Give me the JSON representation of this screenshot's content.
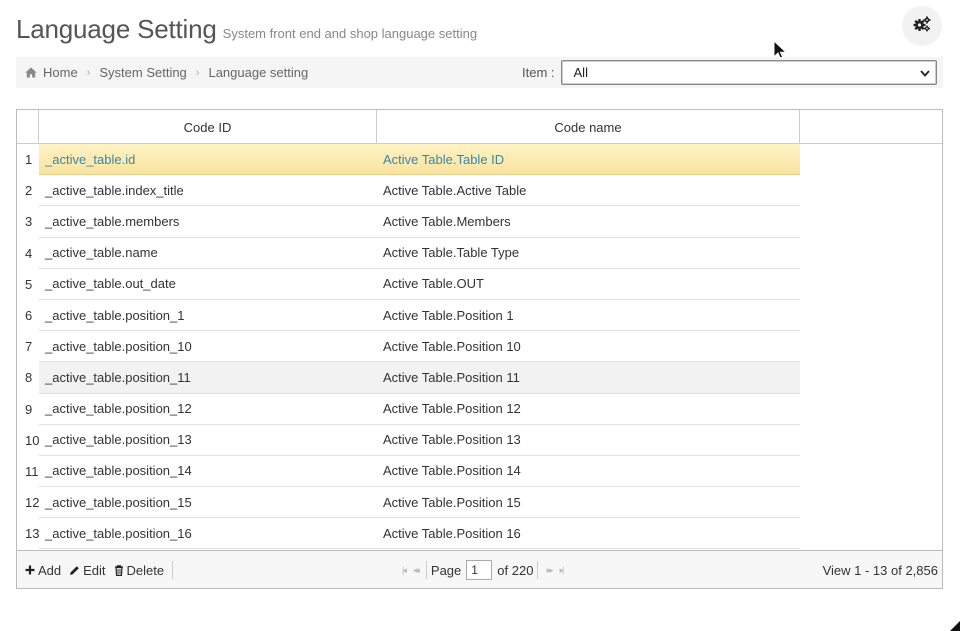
{
  "header": {
    "title": "Language Setting",
    "subtitle": "System front end and shop language setting"
  },
  "breadcrumb": {
    "items": [
      "Home",
      "System Setting",
      "Language setting"
    ],
    "separator": "›"
  },
  "filter": {
    "label": "Item :",
    "selected": "All"
  },
  "grid": {
    "columns": [
      "Code ID",
      "Code name"
    ],
    "rows": [
      {
        "n": "1",
        "id": "_active_table.id",
        "name": "Active Table.Table ID"
      },
      {
        "n": "2",
        "id": "_active_table.index_title",
        "name": "Active Table.Active Table"
      },
      {
        "n": "3",
        "id": "_active_table.members",
        "name": "Active Table.Members"
      },
      {
        "n": "4",
        "id": "_active_table.name",
        "name": "Active Table.Table Type"
      },
      {
        "n": "5",
        "id": "_active_table.out_date",
        "name": "Active Table.OUT"
      },
      {
        "n": "6",
        "id": "_active_table.position_1",
        "name": "Active Table.Position 1"
      },
      {
        "n": "7",
        "id": "_active_table.position_10",
        "name": "Active Table.Position 10"
      },
      {
        "n": "8",
        "id": "_active_table.position_11",
        "name": "Active Table.Position 11"
      },
      {
        "n": "9",
        "id": "_active_table.position_12",
        "name": "Active Table.Position 12"
      },
      {
        "n": "10",
        "id": "_active_table.position_13",
        "name": "Active Table.Position 13"
      },
      {
        "n": "11",
        "id": "_active_table.position_14",
        "name": "Active Table.Position 14"
      },
      {
        "n": "12",
        "id": "_active_table.position_15",
        "name": "Active Table.Position 15"
      },
      {
        "n": "13",
        "id": "_active_table.position_16",
        "name": "Active Table.Position 16"
      }
    ]
  },
  "footer": {
    "actions": {
      "add": "Add",
      "edit": "Edit",
      "delete": "Delete"
    },
    "pager": {
      "page_label": "Page",
      "current": "1",
      "of_label": "of 220"
    },
    "view_info": "View 1 - 13 of 2,856"
  },
  "icons": {
    "settings": "gears-icon",
    "home": "home-icon",
    "add": "plus-icon",
    "edit": "pencil-icon",
    "delete": "trash-icon"
  },
  "colors": {
    "selected_row": "#fbe9b0",
    "selected_text": "#3a87a8",
    "hover_row": "#f2f2f2"
  }
}
